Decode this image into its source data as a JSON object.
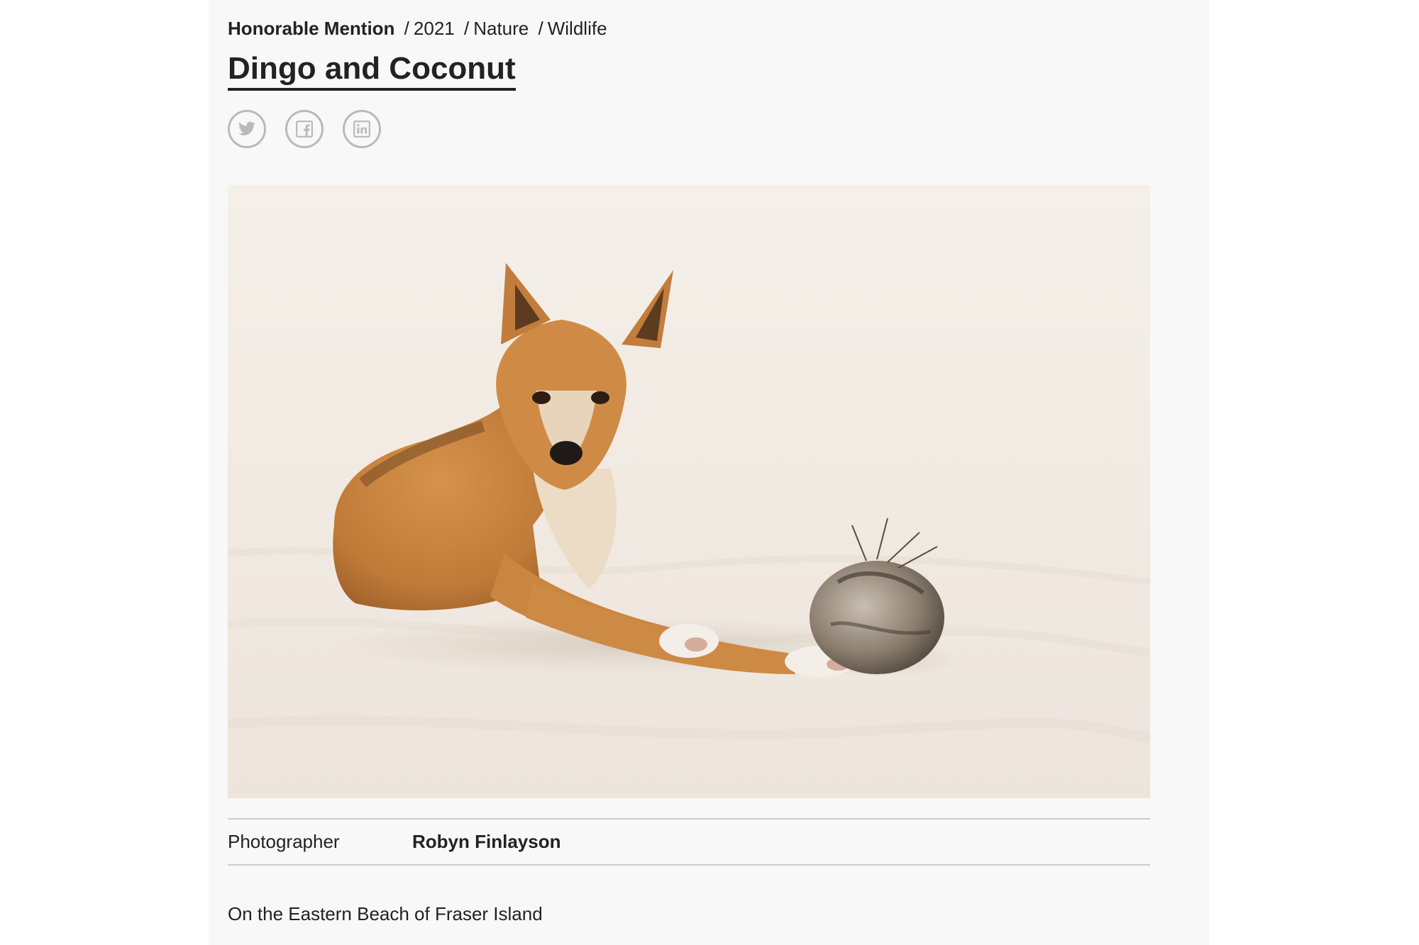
{
  "entry": {
    "award": "Honorable Mention",
    "year": "2021",
    "category": "Nature",
    "subcategory": "Wildlife",
    "separator": "/",
    "title": "Dingo and Coconut"
  },
  "share": [
    {
      "name": "twitter",
      "icon": "twitter-icon"
    },
    {
      "name": "facebook",
      "icon": "facebook-icon"
    },
    {
      "name": "linkedin",
      "icon": "linkedin-icon"
    }
  ],
  "credits": {
    "photographer_label": "Photographer",
    "photographer_name": "Robyn Finlayson"
  },
  "description": "On the Eastern Beach of Fraser Island",
  "colors": {
    "text": "#222222",
    "card_background": "#f8f8f8",
    "icon_gray": "#b9b9b9",
    "divider": "#cccccc",
    "sand": "#f1ebe4",
    "dingo_fur": "#c98640"
  }
}
